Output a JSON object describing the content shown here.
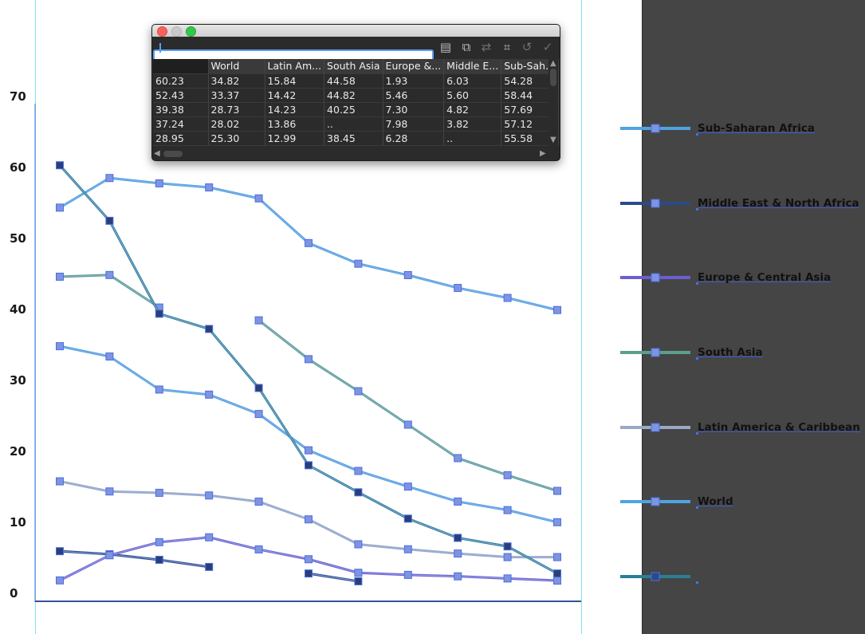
{
  "chart_data": {
    "type": "line",
    "ylim": [
      0,
      70
    ],
    "yticks": [
      "0",
      "10",
      "20",
      "30",
      "40",
      "50",
      "60",
      "70"
    ],
    "x": [
      0,
      1,
      2,
      3,
      4,
      5,
      6,
      7,
      8,
      9,
      10
    ],
    "series": [
      {
        "name": "Sub-Saharan Africa",
        "color": "#4fa3e0",
        "values": [
          54.28,
          58.44,
          57.69,
          57.12,
          55.58,
          49.3,
          46.4,
          44.8,
          43.0,
          41.6,
          39.9
        ]
      },
      {
        "name": "Middle East & North Africa",
        "color": "#2a4a8a",
        "values": [
          6.03,
          5.6,
          4.82,
          3.82,
          null,
          2.9,
          1.8,
          null,
          null,
          null,
          null
        ]
      },
      {
        "name": "Europe & Central Asia",
        "color": "#6a5fd0",
        "values": [
          1.93,
          5.46,
          7.3,
          7.98,
          6.28,
          4.9,
          3.0,
          2.7,
          2.5,
          2.2,
          1.9
        ]
      },
      {
        "name": "South Asia",
        "color": "#5aa08c",
        "values": [
          44.58,
          44.82,
          40.25,
          null,
          38.45,
          33.0,
          28.5,
          23.8,
          19.1,
          16.7,
          14.5
        ]
      },
      {
        "name": "Latin America & Caribbean",
        "color": "#9aaac4",
        "values": [
          15.84,
          14.42,
          14.23,
          13.86,
          12.99,
          10.5,
          7.0,
          6.3,
          5.7,
          5.2,
          5.2
        ]
      },
      {
        "name": "World",
        "color": "#4fa3e0",
        "values": [
          34.82,
          33.37,
          28.73,
          28.02,
          25.3,
          20.2,
          17.3,
          15.1,
          13.0,
          11.8,
          10.1
        ]
      },
      {
        "name": "",
        "color": "#2a7f95",
        "values": [
          60.23,
          52.43,
          39.38,
          37.24,
          28.95,
          18.1,
          14.3,
          10.6,
          7.9,
          6.7,
          2.9
        ]
      }
    ]
  },
  "legend": {
    "items": [
      {
        "label": "Sub-Saharan Africa",
        "color": "#4fa3e0"
      },
      {
        "label": "Middle East & North Africa",
        "color": "#2a4a8a"
      },
      {
        "label": "Europe & Central Asia",
        "color": "#6a5fd0"
      },
      {
        "label": "South Asia",
        "color": "#5aa08c"
      },
      {
        "label": "Latin America & Caribbean",
        "color": "#9aaac4"
      },
      {
        "label": "World",
        "color": "#4fa3e0"
      },
      {
        "label": "",
        "color": "#2a7f95"
      }
    ]
  },
  "sheet": {
    "input_value": "",
    "toolbar_icons": [
      "import-data-icon",
      "switch-rows-columns-icon",
      "transpose-icon",
      "cell-style-icon",
      "undo-icon",
      "apply-icon"
    ],
    "headers": [
      "",
      "World",
      "Latin Am...",
      "South Asia",
      "Europe &...",
      "Middle E...",
      "Sub-Sah..."
    ],
    "rows": [
      [
        "60.23",
        "34.82",
        "15.84",
        "44.58",
        "1.93",
        "6.03",
        "54.28"
      ],
      [
        "52.43",
        "33.37",
        "14.42",
        "44.82",
        "5.46",
        "5.60",
        "58.44"
      ],
      [
        "39.38",
        "28.73",
        "14.23",
        "40.25",
        "7.30",
        "4.82",
        "57.69"
      ],
      [
        "37.24",
        "28.02",
        "13.86",
        "..",
        "7.98",
        "3.82",
        "57.12"
      ],
      [
        "28.95",
        "25.30",
        "12.99",
        "38.45",
        "6.28",
        "..",
        "55.58"
      ]
    ]
  }
}
